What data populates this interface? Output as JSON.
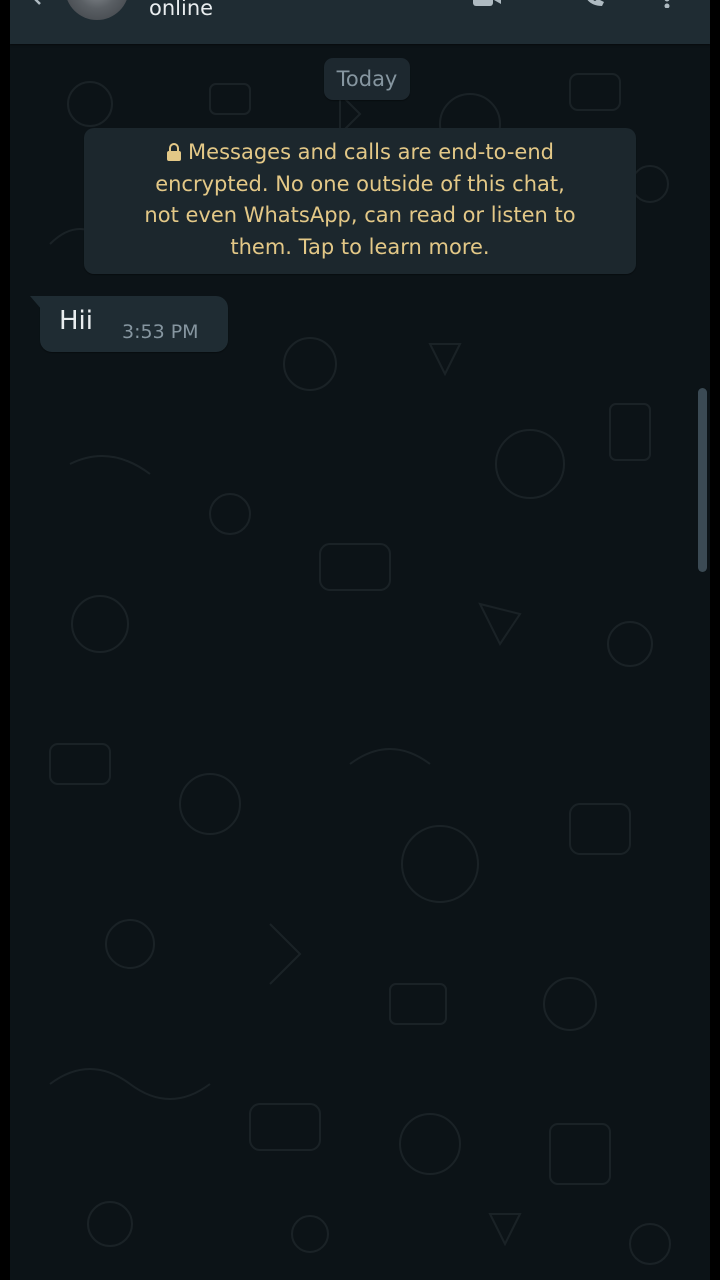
{
  "header": {
    "status": "online",
    "icons": [
      "back-arrow-icon",
      "avatar",
      "video-call-icon",
      "voice-call-icon",
      "more-options-icon"
    ]
  },
  "chat": {
    "date_chip": "Today",
    "encryption_notice": {
      "icon": "lock-icon",
      "text": "Messages and calls are end-to-end encrypted. No one outside of this chat, not even WhatsApp, can read or listen to them. Tap to learn more.",
      "lines": [
        "Messages and calls are end-to-end",
        "encrypted.  No one outside of this chat,",
        "not even WhatsApp,  can read or listen to",
        "them.  Tap to learn more."
      ]
    },
    "messages": [
      {
        "direction": "incoming",
        "text": "Hii",
        "time": "3:53 PM"
      }
    ]
  },
  "colors": {
    "chat_background": "#0c1317",
    "header_background": "#1f2c33",
    "incoming_bubble": "#1f2c33",
    "notice_text": "#e3c887",
    "primary_text": "#e9edef",
    "secondary_text": "#8696a0"
  }
}
